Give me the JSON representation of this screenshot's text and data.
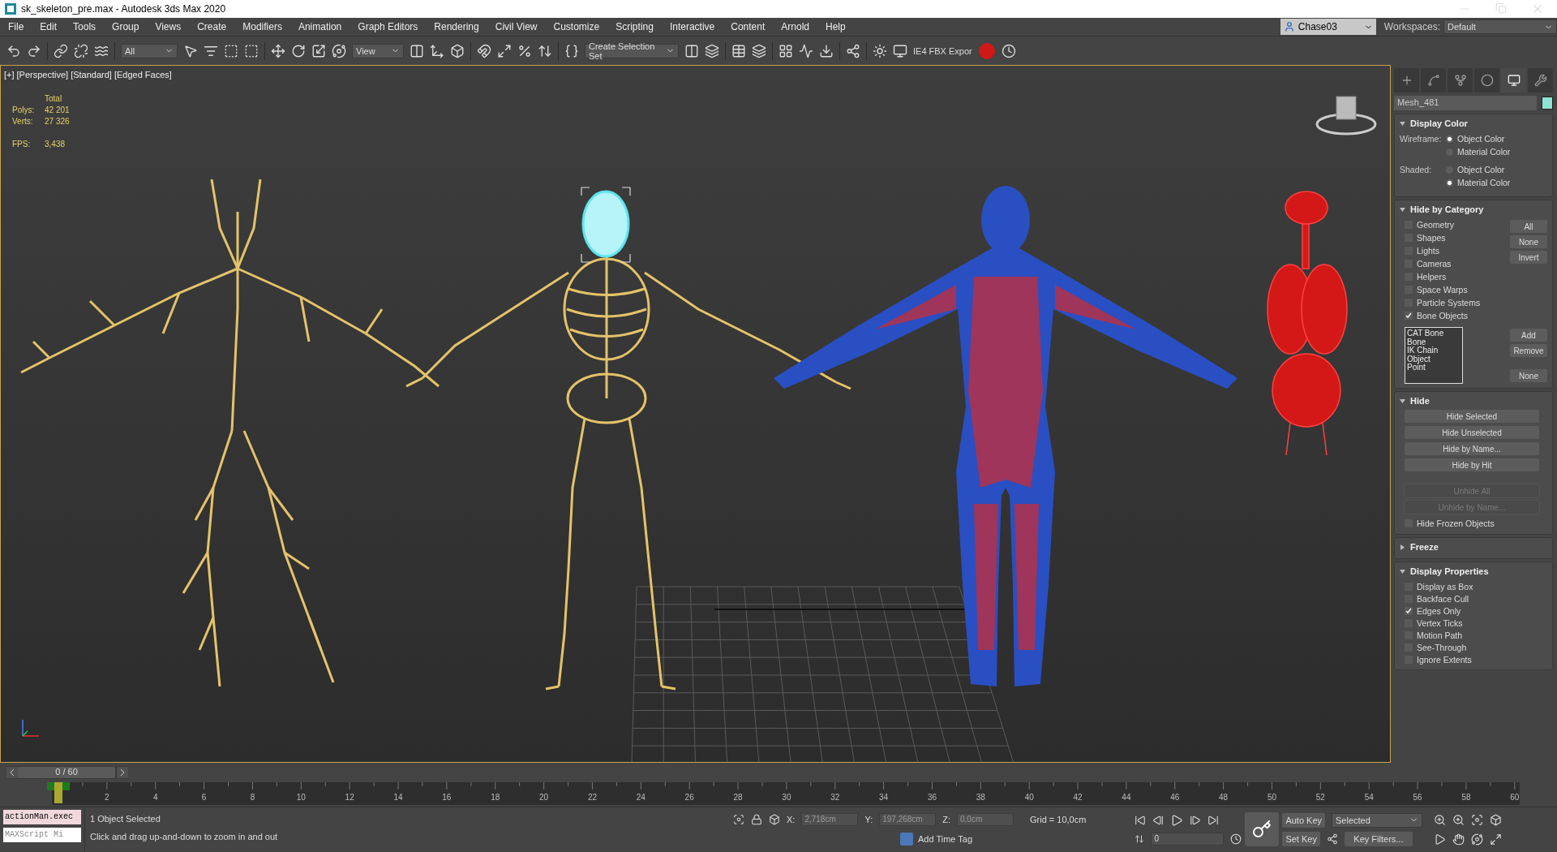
{
  "window": {
    "title": "sk_skeleton_pre.max - Autodesk 3ds Max 2020"
  },
  "menu": [
    "File",
    "Edit",
    "Tools",
    "Group",
    "Views",
    "Create",
    "Modifiers",
    "Animation",
    "Graph Editors",
    "Rendering",
    "Civil View",
    "Customize",
    "Scripting",
    "Interactive",
    "Content",
    "Arnold",
    "Help"
  ],
  "account": {
    "user": "Chase03",
    "workspaces_label": "Workspaces:",
    "workspace": "Default"
  },
  "toolbar": {
    "filter": "All",
    "coordinate_system": "View",
    "selection_set": "Create Selection Set",
    "exporter": "IE4 FBX Expor"
  },
  "viewport": {
    "labels": [
      "[+]",
      "[Perspective]",
      "[Standard]",
      "[Edged Faces]"
    ],
    "stats": [
      {
        "value": "Total"
      },
      {
        "label": "Polys:",
        "value": "42 201"
      },
      {
        "label": "Verts:",
        "value": "27 326"
      },
      {
        "label": "FPS:",
        "value": "3,438"
      }
    ]
  },
  "panel": {
    "tabs": [
      {
        "kind": "create",
        "selected": false
      },
      {
        "kind": "modify",
        "selected": false
      },
      {
        "kind": "hierarchy",
        "selected": false
      },
      {
        "kind": "motion",
        "selected": false
      },
      {
        "kind": "display",
        "selected": true
      },
      {
        "kind": "utilities",
        "selected": false
      }
    ],
    "object_name": "Mesh_481",
    "display_color": {
      "title": "Display Color",
      "expanded": true,
      "groups": [
        {
          "label": "Wireframe:",
          "options": [
            {
              "label": "Object Color",
              "selected": true
            },
            {
              "label": "Material Color",
              "selected": false
            }
          ]
        },
        {
          "label": "Shaded:",
          "options": [
            {
              "label": "Object Color",
              "selected": false
            },
            {
              "label": "Material Color",
              "selected": true
            }
          ]
        }
      ]
    },
    "hide_by_category": {
      "title": "Hide by Category",
      "expanded": true,
      "categories": [
        {
          "label": "Geometry",
          "checked": false
        },
        {
          "label": "Shapes",
          "checked": false
        },
        {
          "label": "Lights",
          "checked": false
        },
        {
          "label": "Cameras",
          "checked": false
        },
        {
          "label": "Helpers",
          "checked": false
        },
        {
          "label": "Space Warps",
          "checked": false
        },
        {
          "label": "Particle Systems",
          "checked": false
        },
        {
          "label": "Bone Objects",
          "checked": true
        }
      ],
      "buttons": [
        "All",
        "None",
        "Invert"
      ],
      "list": [
        "CAT Bone",
        "Bone",
        "IK Chain Object",
        "Point"
      ],
      "list_buttons": [
        "Add",
        "Remove",
        "None"
      ]
    },
    "hide": {
      "title": "Hide",
      "expanded": true,
      "buttons": [
        {
          "label": "Hide Selected",
          "disabled": false
        },
        {
          "label": "Hide Unselected",
          "disabled": false
        },
        {
          "label": "Hide by Name...",
          "disabled": false
        },
        {
          "label": "Hide by Hit",
          "disabled": false
        }
      ],
      "unhide_buttons": [
        {
          "label": "Unhide All",
          "disabled": true
        },
        {
          "label": "Unhide by Name...",
          "disabled": true
        }
      ],
      "hide_frozen": {
        "label": "Hide Frozen Objects",
        "checked": false
      }
    },
    "freeze": {
      "title": "Freeze",
      "expanded": false
    },
    "display_properties": {
      "title": "Display Properties",
      "expanded": true,
      "options": [
        {
          "label": "Display as Box",
          "checked": false
        },
        {
          "label": "Backface Cull",
          "checked": false
        },
        {
          "label": "Edges Only",
          "checked": true
        },
        {
          "label": "Vertex Ticks",
          "checked": false
        },
        {
          "label": "Motion Path",
          "checked": false
        },
        {
          "label": "See-Through",
          "checked": false
        },
        {
          "label": "Ignore Extents",
          "checked": false
        }
      ]
    }
  },
  "timeline": {
    "slider": "0 / 60",
    "labels": [
      "2",
      "4",
      "6",
      "8",
      "10",
      "12",
      "14",
      "16",
      "18",
      "20",
      "22",
      "24",
      "26",
      "28",
      "30",
      "32",
      "34",
      "36",
      "38",
      "40",
      "42",
      "44",
      "46",
      "48",
      "50",
      "52",
      "54",
      "56",
      "58",
      "60"
    ]
  },
  "status": {
    "script_lines": [
      "actionMan.exec",
      "MAXScript Mi"
    ],
    "message": "1 Object Selected",
    "prompt": "Click and drag up-and-down to zoom in and out",
    "coords": [
      {
        "label": "X:",
        "value": "2,718cm"
      },
      {
        "label": "Y:",
        "value": "197,268cm"
      },
      {
        "label": "Z:",
        "value": "0,0cm"
      }
    ],
    "grid": "Grid = 10,0cm",
    "time_tag": "Add Time Tag",
    "frame": "0",
    "auto_key": "Auto Key",
    "key_mode": "Selected",
    "set_key": "Set Key",
    "key_filters": "Key Filters..."
  }
}
